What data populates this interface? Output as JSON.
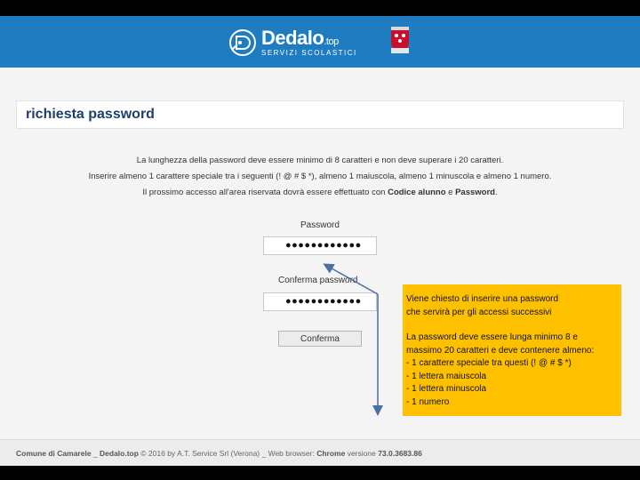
{
  "header": {
    "logo_title": "Dedalo",
    "logo_suffix": ".top",
    "logo_subtitle": "SERVIZI SCOLASTICI"
  },
  "page": {
    "title": "richiesta password"
  },
  "info": {
    "line1": "La lunghezza della password deve essere minimo di 8 caratteri e non deve superare i 20 caratteri.",
    "line2": "Inserire almeno 1 carattere speciale tra i seguenti (! @ # $ *), almeno 1 maiuscola, almeno 1 minuscola e almeno 1 numero.",
    "line3_pre": "Il prossimo accesso all'area riservata dovrà essere effettuato con ",
    "line3_b1": "Codice alunno",
    "line3_mid": " e ",
    "line3_b2": "Password",
    "line3_end": "."
  },
  "form": {
    "password_label": "Password",
    "password_value": "●●●●●●●●●●●●",
    "confirm_label": "Conferma password",
    "confirm_value": "●●●●●●●●●●●●",
    "confirm_button": "Conferma"
  },
  "callout": {
    "para1": "Viene chiesto di inserire una password\nche servirà per gli accessi successivi",
    "para2": "La password deve essere lunga minimo 8 e\nmassimo 20 caratteri e deve contenere almeno:\n- 1 carattere speciale tra questi (! @ # $ *)\n- 1 lettera maiuscola\n- 1 lettera minuscola\n- 1 numero"
  },
  "footer": {
    "comune": "Comune di Camarele",
    "sep1": " _ ",
    "site": "Dedalo.top",
    "copyright": " © 2016 by A.T. Service Srl (Verona) _ Web browser: ",
    "browser": "Chrome",
    "version_label": " versione ",
    "version": "73.0.3683.86"
  },
  "colors": {
    "header_blue": "#1f7cc1",
    "callout_yellow": "#ffc000",
    "title_navy": "#1f3f6a"
  }
}
